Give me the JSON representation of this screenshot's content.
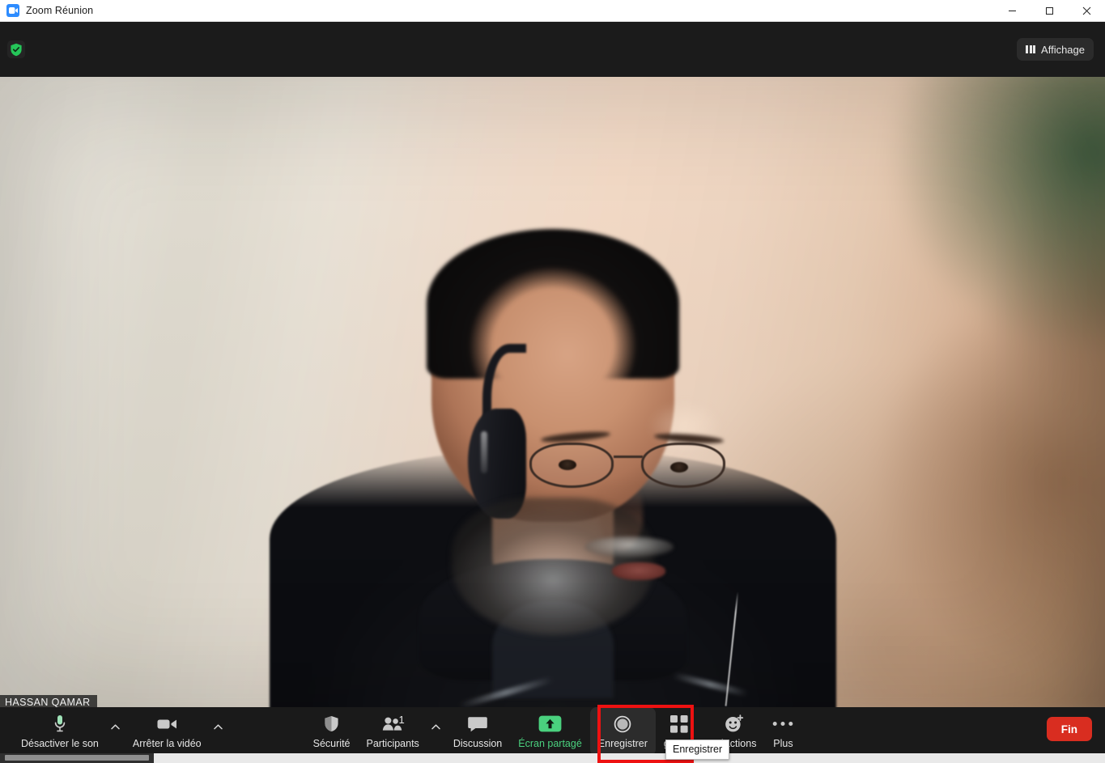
{
  "window": {
    "title": "Zoom Réunion",
    "app_icon": "zoom-camera-icon",
    "controls": {
      "minimize": "minimize-icon",
      "maximize": "maximize-icon",
      "close": "close-icon"
    }
  },
  "header": {
    "encryption_badge": "green-shield-check-icon",
    "view_button": {
      "label": "Affichage",
      "icon": "grid-view-icon"
    }
  },
  "stage": {
    "participant_name": "HASSAN QAMAR"
  },
  "toolbar": {
    "audio": {
      "label": "Désactiver le son",
      "icon": "microphone-icon",
      "icon_color": "#4ad17e",
      "caret": "chevron-up-icon"
    },
    "video": {
      "label": "Arrêter la vidéo",
      "icon": "video-camera-icon",
      "caret": "chevron-up-icon"
    },
    "security": {
      "label": "Sécurité",
      "icon": "shield-icon"
    },
    "participants": {
      "label": "Participants",
      "icon": "participants-icon",
      "count": "1",
      "caret": "chevron-up-icon"
    },
    "chat": {
      "label": "Discussion",
      "icon": "chat-bubble-icon"
    },
    "share": {
      "label": "Écran partagé",
      "icon": "share-screen-up-arrow-icon",
      "color": "#4ad17e"
    },
    "record": {
      "label": "Enregistrer",
      "icon": "record-circle-icon",
      "tooltip": "Enregistrer",
      "highlight_color": "#ee1111"
    },
    "breakout": {
      "label": "groupe",
      "icon": "breakout-rooms-grid-icon"
    },
    "reactions": {
      "label": "Réactions",
      "icon": "smiley-plus-icon"
    },
    "more": {
      "label": "Plus",
      "icon": "ellipsis-icon"
    },
    "end": {
      "label": "Fin",
      "color": "#d92d20"
    }
  }
}
